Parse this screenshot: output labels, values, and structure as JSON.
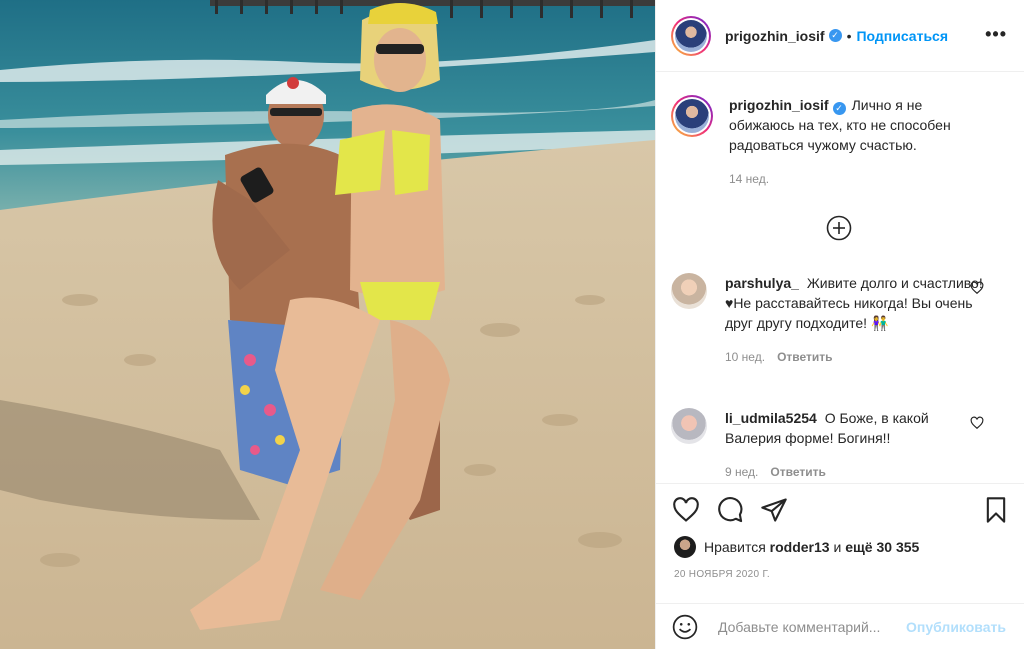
{
  "post": {
    "username": "prigozhin_iosif",
    "follow_label": "Подписаться",
    "more_label": "•••"
  },
  "caption": {
    "username": "prigozhin_iosif",
    "text": "Лично я не обижаюсь на тех, кто не способен радоваться чужому счастью.",
    "time": "14 нед."
  },
  "comments": [
    {
      "username": "parshulya_",
      "text": "Живите долго и счастливо! ♥Не расставайтесь никогда! Вы очень друг другу подходите!",
      "emoji": "👫",
      "time": "10 нед.",
      "reply_label": "Ответить"
    },
    {
      "username": "li_udmila5254",
      "text": "О Боже, в какой Валерия форме! Богиня!!",
      "time": "9 нед.",
      "reply_label": "Ответить"
    }
  ],
  "likes": {
    "prefix": "Нравится",
    "user": "rodder13",
    "middle": "и",
    "count": "ещё 30 355"
  },
  "date": "20 НОЯБРЯ 2020 Г.",
  "comment_box": {
    "placeholder": "Добавьте комментарий...",
    "publish_label": "Опубликовать"
  },
  "icons": {
    "verified": "verified-badge-icon",
    "more": "more-options-icon",
    "load_more": "plus-circle-icon",
    "like": "heart-icon",
    "comment": "comment-bubble-icon",
    "share": "paper-plane-icon",
    "save": "bookmark-icon",
    "emoji": "smiley-icon"
  },
  "colors": {
    "accent": "#0095f6",
    "verified": "#3897f0",
    "muted": "#8e8e8e",
    "publish_disabled": "#b2dffc"
  }
}
